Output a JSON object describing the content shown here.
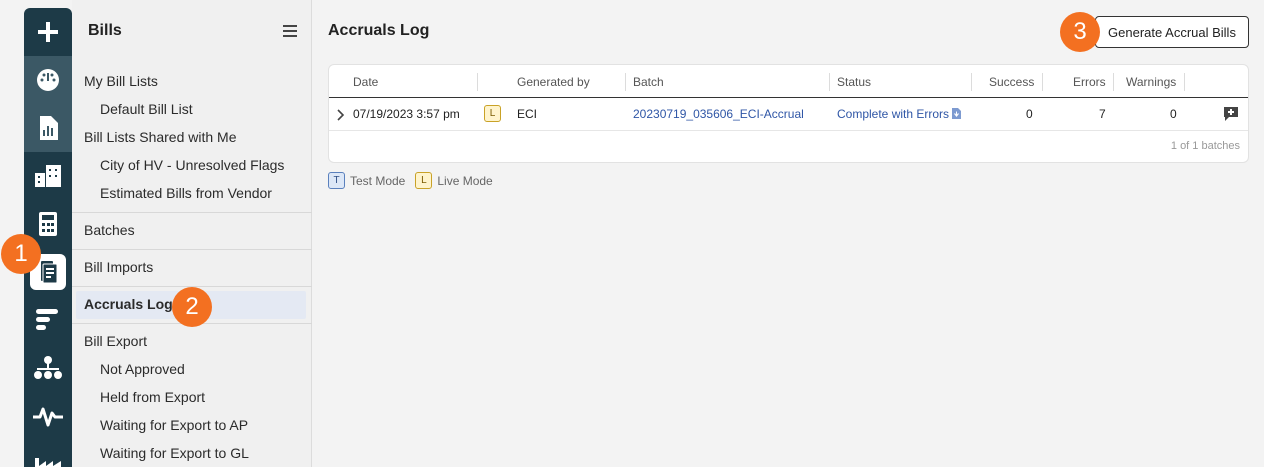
{
  "rail": {
    "icons": [
      "plus-icon",
      "dashboard-icon",
      "reports-icon",
      "buildings-icon",
      "calculator-icon",
      "bills-icon",
      "gantt-icon",
      "org-chart-icon",
      "pulse-icon",
      "factory-icon"
    ]
  },
  "sidebar": {
    "title": "Bills",
    "items": [
      {
        "label": "My Bill Lists"
      },
      {
        "label": "Default Bill List"
      },
      {
        "label": "Bill Lists Shared with Me"
      },
      {
        "label": "City of HV - Unresolved Flags"
      },
      {
        "label": "Estimated Bills from Vendor"
      },
      {
        "label": "Batches"
      },
      {
        "label": "Bill Imports"
      },
      {
        "label": "Accruals Log"
      },
      {
        "label": "Bill Export"
      },
      {
        "label": "Not Approved"
      },
      {
        "label": "Held from Export"
      },
      {
        "label": "Waiting for Export to AP"
      },
      {
        "label": "Waiting for Export to GL"
      }
    ]
  },
  "main": {
    "title": "Accruals Log",
    "generate_button": "Generate Accrual Bills",
    "table": {
      "columns": [
        "Date",
        "Generated by",
        "Batch",
        "Status",
        "Success",
        "Errors",
        "Warnings"
      ],
      "rows": [
        {
          "date": "07/19/2023 3:57 pm",
          "mode_badge": "L",
          "generated_by": "ECI",
          "batch": "20230719_035606_ECI-Accrual",
          "status": "Complete with Errors",
          "success": "0",
          "errors": "7",
          "warnings": "0"
        }
      ],
      "footer": "1 of 1 batches"
    },
    "legend": [
      {
        "badge": "T",
        "label": "Test Mode"
      },
      {
        "badge": "L",
        "label": "Live Mode"
      }
    ]
  },
  "callouts": [
    "1",
    "2",
    "3"
  ],
  "colors": {
    "rail_bg": "#1d3a47",
    "callout": "#f37021",
    "link": "#2f56a6"
  }
}
